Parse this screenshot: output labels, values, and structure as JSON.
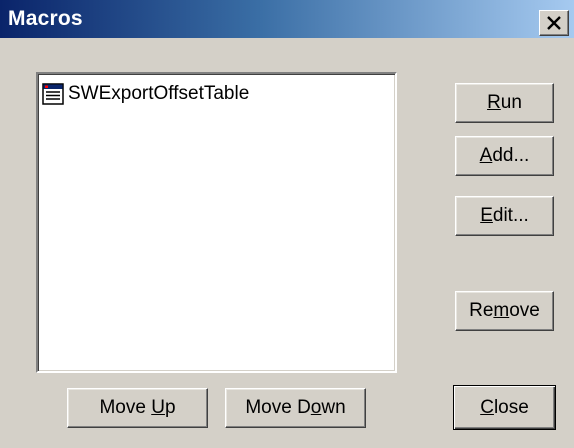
{
  "window": {
    "title": "Macros",
    "close_glyph": "X"
  },
  "macro_list": {
    "items": [
      {
        "label": "SWExportOffsetTable",
        "icon": "macro-icon"
      }
    ]
  },
  "buttons": {
    "run": {
      "pre": "",
      "mnemonic": "R",
      "post": "un"
    },
    "add": {
      "pre": "",
      "mnemonic": "A",
      "post": "dd..."
    },
    "edit": {
      "pre": "",
      "mnemonic": "E",
      "post": "dit..."
    },
    "remove": {
      "pre": "Re",
      "mnemonic": "m",
      "post": "ove"
    },
    "move_up": {
      "pre": "Move ",
      "mnemonic": "U",
      "post": "p"
    },
    "move_down": {
      "pre": "Move D",
      "mnemonic": "o",
      "post": "wn"
    },
    "close": {
      "pre": "",
      "mnemonic": "C",
      "post": "lose"
    }
  },
  "colors": {
    "title_start": "#0a246a",
    "title_end": "#a6caf0",
    "face": "#d4d0c8"
  }
}
